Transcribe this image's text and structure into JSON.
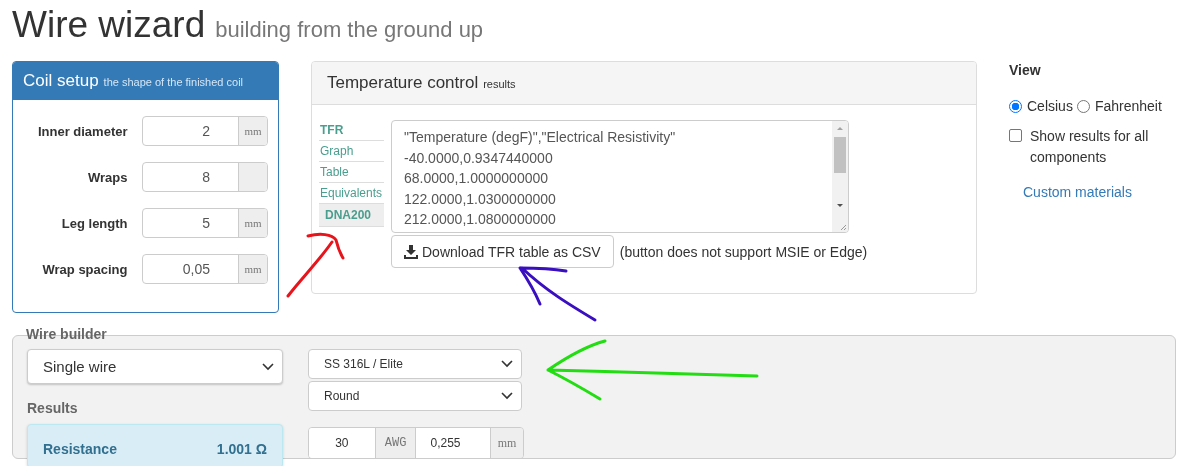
{
  "title": "Wire wizard",
  "subtitle": "building from the ground up",
  "coil_setup": {
    "title": "Coil setup",
    "subtitle": "the shape of the finished coil",
    "fields": [
      {
        "label": "Inner diameter",
        "value": "2",
        "unit": "mm"
      },
      {
        "label": "Wraps",
        "value": "8"
      },
      {
        "label": "Leg length",
        "value": "5",
        "unit": "mm"
      },
      {
        "label": "Wrap spacing",
        "value": "0,05",
        "unit": "mm"
      }
    ]
  },
  "temperature_control": {
    "title": "Temperature control",
    "subtitle": "results",
    "tabs": [
      {
        "label": "TFR",
        "kind": "tab",
        "selected": true
      },
      {
        "label": "Graph",
        "kind": "tab",
        "selected": false
      },
      {
        "label": "Table",
        "kind": "tab",
        "selected": false
      },
      {
        "label": "Equivalents",
        "kind": "tab",
        "selected": false
      },
      {
        "label": "DNA200",
        "kind": "device",
        "selected": true
      }
    ],
    "csv_lines": [
      "\"Temperature (degF)\",\"Electrical Resistivity\"",
      "-40.0000,0.9347440000",
      "68.0000,1.0000000000",
      "122.0000,1.0300000000",
      "212.0000,1.0800000000"
    ],
    "download_button": "Download TFR table as CSV",
    "note": "(button does not support MSIE or Edge)"
  },
  "view": {
    "title": "View",
    "units": [
      {
        "label": "Celsius",
        "selected": true
      },
      {
        "label": "Fahrenheit",
        "selected": false
      }
    ],
    "show_all": {
      "label": "Show results for all components",
      "checked": false
    },
    "link": "Custom materials"
  },
  "wire_builder": {
    "title": "Wire builder",
    "mode": "Single wire",
    "material": "SS 316L / Elite",
    "profile": "Round",
    "results_title": "Results",
    "resistance": {
      "label": "Resistance",
      "value": "1.001 Ω"
    },
    "gauge": {
      "value": "30",
      "unit": "AWG"
    },
    "diameter": {
      "value": "0,255",
      "unit": "mm"
    }
  },
  "annotations": [
    {
      "color": "#e8141b"
    },
    {
      "color": "#3a0fc0"
    },
    {
      "color": "#22dd11"
    }
  ]
}
